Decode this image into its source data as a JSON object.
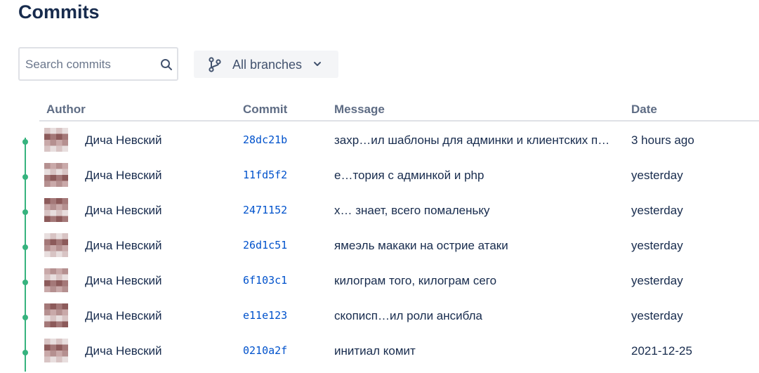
{
  "page_title": "Commits",
  "search": {
    "placeholder": "Search commits",
    "value": ""
  },
  "branch_filter": {
    "label": "All branches"
  },
  "columns": {
    "author": "Author",
    "commit": "Commit",
    "message": "Message",
    "date": "Date"
  },
  "icons": {
    "search": "search-icon",
    "branch": "branch-icon",
    "dropdown": "chevron-down-icon",
    "avatar": "avatar"
  },
  "colors": {
    "graph": "#36b37e",
    "hash_link": "#0052cc"
  },
  "commits": [
    {
      "author": "Дича Невский",
      "hash": "28dc21b",
      "message": "захр…ил шаблоны для админки и клиентских п…",
      "date": "3 hours ago"
    },
    {
      "author": "Дича Невский",
      "hash": "11fd5f2",
      "message": "е…тория с админкой и php",
      "date": "yesterday"
    },
    {
      "author": "Дича Невский",
      "hash": "2471152",
      "message": "х… знает, всего помаленьку",
      "date": "yesterday"
    },
    {
      "author": "Дича Невский",
      "hash": "26d1c51",
      "message": "ямеэль макаки на острие атаки",
      "date": "yesterday"
    },
    {
      "author": "Дича Невский",
      "hash": "6f103c1",
      "message": "килограм того, килограм сего",
      "date": "yesterday"
    },
    {
      "author": "Дича Невский",
      "hash": "e11e123",
      "message": "скописп…ил роли ансибла",
      "date": "yesterday"
    },
    {
      "author": "Дича Невский",
      "hash": "0210a2f",
      "message": "инитиал комит",
      "date": "2021-12-25"
    }
  ]
}
